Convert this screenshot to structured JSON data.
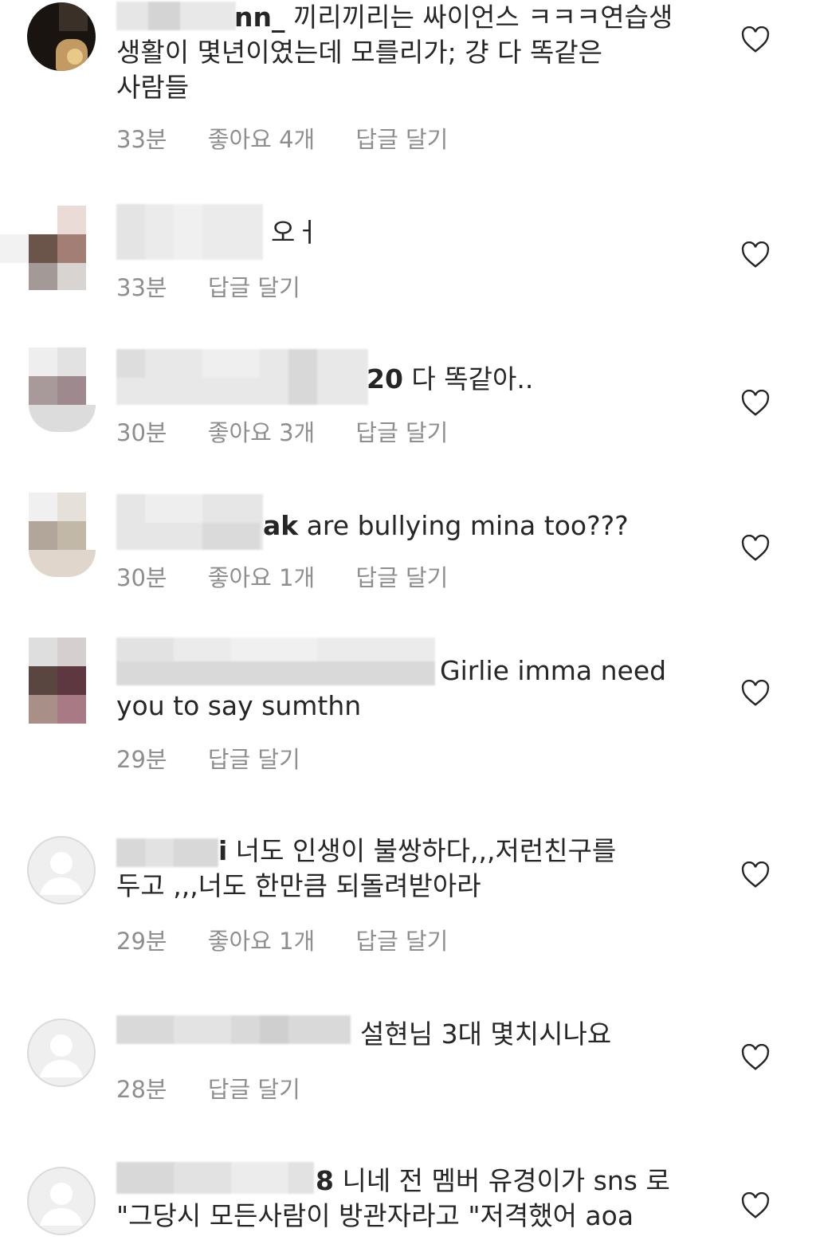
{
  "comments": [
    {
      "username_visible": "nn_",
      "text_lines": [
        "끼리끼리는 싸이언스 ㅋㅋㅋ연습생",
        "생활이 몇년이였는데 모를리가; 걍 다 똑같은",
        "사람들"
      ],
      "time": "33분",
      "likes": "좋아요 4개",
      "reply": "답글 달기"
    },
    {
      "username_visible": "",
      "text_lines": [
        "오ㅓ"
      ],
      "time": "33분",
      "likes": "",
      "reply": "답글 달기"
    },
    {
      "username_visible": "20",
      "text_lines": [
        " 다 똑같아.."
      ],
      "time": "30분",
      "likes": "좋아요 3개",
      "reply": "답글 달기"
    },
    {
      "username_visible": "ak",
      "text_lines": [
        " are bullying mina too???"
      ],
      "time": "30분",
      "likes": "좋아요 1개",
      "reply": "답글 달기"
    },
    {
      "username_visible": "",
      "text_lines": [
        "Girlie imma need",
        "you to say sumthn"
      ],
      "time": "29분",
      "likes": "",
      "reply": "답글 달기"
    },
    {
      "username_visible": "i",
      "text_lines": [
        " 너도 인생이 불쌍하다,,,저런친구를",
        "두고 ,,,너도 한만큼 되돌려받아라"
      ],
      "time": "29분",
      "likes": "좋아요 1개",
      "reply": "답글 달기"
    },
    {
      "username_visible": "",
      "text_lines": [
        "설현님 3대 몇치시나요"
      ],
      "time": "28분",
      "likes": "",
      "reply": "답글 달기"
    },
    {
      "username_visible": "8",
      "text_lines": [
        " 니네 전 멤버 유경이가 sns 로",
        "\"그당시 모든사람이 방관자라고 \"저격했어 aoa"
      ],
      "time": "",
      "likes": "",
      "reply": ""
    }
  ],
  "icons": {
    "like": "heart-outline-icon",
    "avatar_placeholder": "person-icon"
  },
  "colors": {
    "text": "#262626",
    "meta": "#8e8e8e",
    "background": "#ffffff"
  }
}
